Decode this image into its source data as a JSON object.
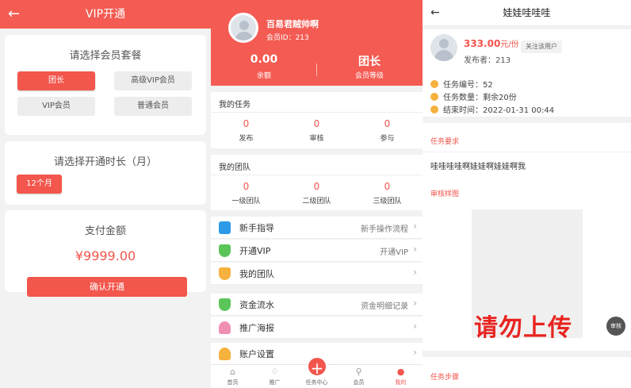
{
  "vip": {
    "title": "VIP开通",
    "back_icon": "arrow-left-icon",
    "package_title": "请选择会员套餐",
    "packages": [
      "团长",
      "高级VIP会员",
      "VIP会员",
      "普通会员"
    ],
    "duration_title": "请选择开通时长（月）",
    "duration_option": "12个月",
    "pay_title": "支付金额",
    "pay_amount": "¥9999.00",
    "confirm_label": "确认开通",
    "accent": "#f2564c"
  },
  "profile": {
    "name": "百易君贼帅啊",
    "member_id": "会员ID：213",
    "balance_value": "0.00",
    "balance_label": "余额",
    "level_value": "团长",
    "level_label": "会员等级",
    "tasks_title": "我的任务",
    "tasks": [
      {
        "value": "0",
        "label": "发布"
      },
      {
        "value": "0",
        "label": "审核"
      },
      {
        "value": "0",
        "label": "参与"
      }
    ],
    "team_title": "我的团队",
    "team": [
      {
        "value": "0",
        "label": "一级团队"
      },
      {
        "value": "0",
        "label": "二级团队"
      },
      {
        "value": "0",
        "label": "三级团队"
      }
    ],
    "menu": [
      {
        "label": "新手指导",
        "right": "新手操作流程",
        "color": "#2d9ae8"
      },
      {
        "label": "开通VIP",
        "right": "开通VIP",
        "color": "#5cc55a"
      },
      {
        "label": "我的团队",
        "right": "",
        "color": "#f6b13e"
      },
      {
        "label": "资金流水",
        "right": "资金明细记录",
        "color": "#5cc55a"
      },
      {
        "label": "推广海报",
        "right": "",
        "color": "#f08fb4"
      },
      {
        "label": "账户设置",
        "right": "",
        "color": "#f6b13e"
      }
    ],
    "tabs": [
      "首页",
      "推广",
      "任务中心",
      "会员",
      "我的"
    ]
  },
  "task": {
    "title": "娃娃哇哇哇",
    "price": "333.00",
    "price_unit": "元/份",
    "follow_label": "关注该用户",
    "publisher": "发布者：213",
    "task_no": "任务编号：52",
    "task_qty": "任务数量：剩余20份",
    "end_time": "结束时间：2022-01-31 00:44",
    "req_title": "任务要求",
    "req_text": "哇哇哇哇啊娃娃啊娃娃啊我",
    "sample_title": "审核样图",
    "watermark": "请勿上传",
    "review_badge": "审核",
    "steps_title": "任务步骤"
  }
}
